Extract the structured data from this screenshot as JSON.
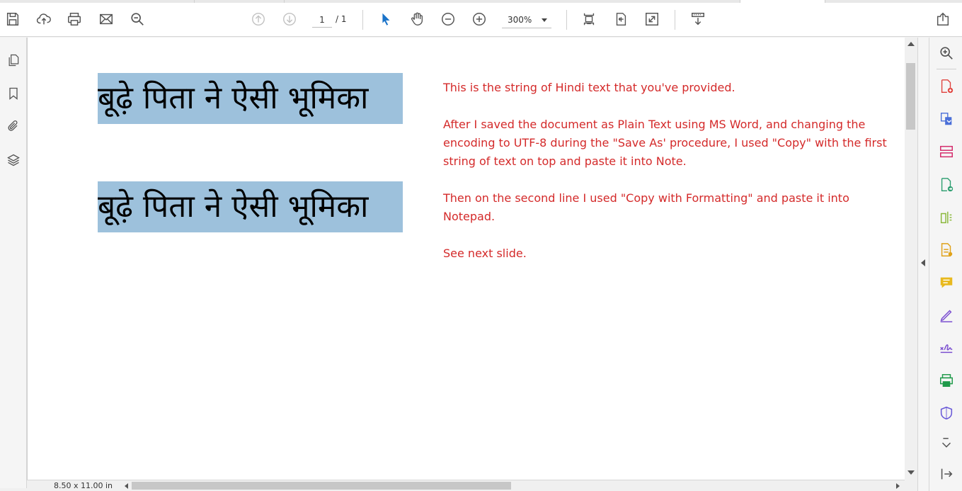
{
  "toolbar": {
    "page_current": "1",
    "page_total": "/ 1",
    "zoom": "300%",
    "icons": [
      "save-icon",
      "upload-icon",
      "print-icon",
      "mail-icon",
      "zoom-search-icon",
      "page-up-icon",
      "page-down-icon",
      "select-arrow-icon",
      "hand-icon",
      "zoom-out-icon",
      "zoom-in-icon",
      "fit-page-icon",
      "rotate-icon",
      "fullscreen-icon",
      "read-mode-icon",
      "share-icon"
    ]
  },
  "document": {
    "hindi_line_1": "बूढ़े पिता ने ऐसी भूमिका",
    "hindi_line_2": "बूढ़े पिता ने ऐसी भूमिका",
    "note_paragraphs": [
      "This is the string of Hindi text that you've provided.",
      "After I saved the  document as Plain Text using MS Word, and changing the encoding to UTF-8 during the \"Save As' procedure,  I used \"Copy\" with the first string of text on top and paste it into Note.",
      "Then on the second line I used \"Copy with Formatting\" and paste it into Notepad.",
      "See next slide."
    ]
  },
  "status": {
    "page_size": "8.50 x 11.00 in"
  },
  "colors": {
    "note_text": "#d42a2a",
    "highlight": "#9dc1dc",
    "select_arrow": "#1a73c9"
  }
}
